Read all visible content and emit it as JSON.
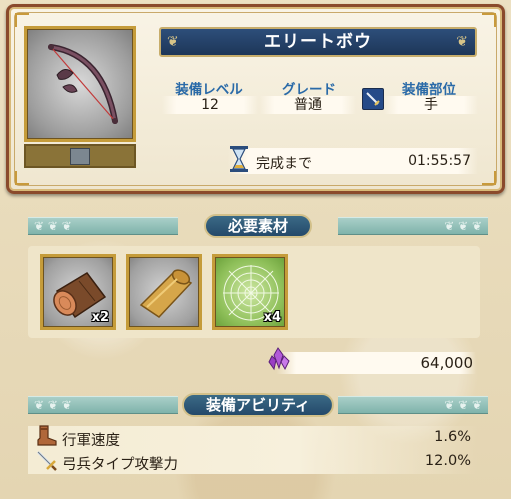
{
  "item": {
    "name": "エリートボウ",
    "icon": "bow-icon"
  },
  "stats": {
    "level_label": "装備レベル",
    "level_value": "12",
    "grade_label": "グレード",
    "grade_value": "普通",
    "slot_label": "装備部位",
    "slot_value": "手",
    "slot_icon": "sword-icon"
  },
  "timer": {
    "label": "完成まで",
    "value": "01:55:57",
    "icon": "hourglass-icon"
  },
  "materials_section": {
    "title": "必要素材",
    "items": [
      {
        "name_icon": "log-icon",
        "qty": "x2"
      },
      {
        "name_icon": "leather-roll-icon",
        "qty": ""
      },
      {
        "name_icon": "spider-web-icon",
        "qty": "x4"
      }
    ],
    "cost_icon": "crystal-icon",
    "cost_value": "64,000"
  },
  "abilities_section": {
    "title": "装備アビリティ",
    "items": [
      {
        "icon": "boot-icon",
        "name": "行軍速度",
        "value": "1.6%"
      },
      {
        "icon": "sword-icon",
        "name": "弓兵タイプ攻撃力",
        "value": "12.0%"
      }
    ]
  },
  "colors": {
    "frame_brown": "#8a4a2c",
    "banner_blue": "#1d3658",
    "label_blue": "#2a6aa8",
    "gold_border": "#c59c3a",
    "ribbon_teal": "#7fb3ab"
  }
}
